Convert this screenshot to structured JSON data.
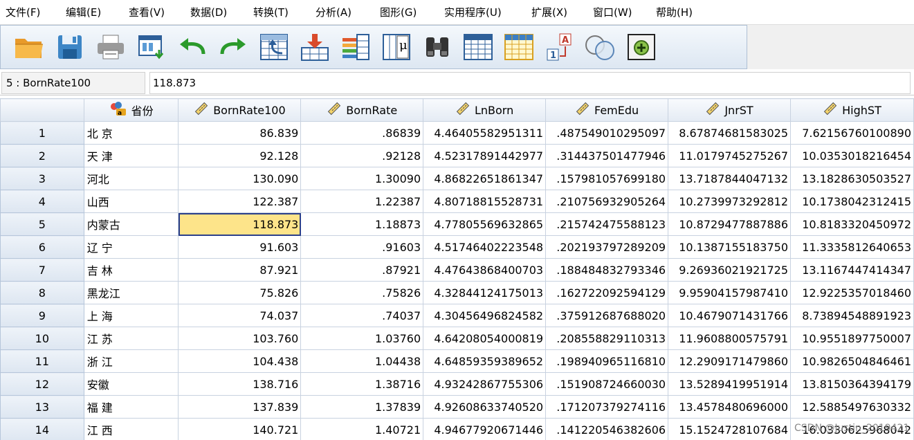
{
  "menu": [
    "文件(F)",
    "编辑(E)",
    "查看(V)",
    "数据(D)",
    "转换(T)",
    "分析(A)",
    "图形(G)",
    "实用程序(U)",
    "扩展(X)",
    "窗口(W)",
    "帮助(H)"
  ],
  "toolbar": {
    "icons": [
      "open-folder-icon",
      "save-icon",
      "print-icon",
      "recall-dialog-icon",
      "undo-icon",
      "redo-icon",
      "goto-case-icon",
      "goto-variable-icon",
      "variables-icon",
      "run-descriptives-icon",
      "find-icon",
      "insert-cases-icon",
      "insert-variable-icon",
      "value-labels-icon",
      "use-sets-icon",
      "customize-icon"
    ]
  },
  "refbar": {
    "cell_name": "5 : BornRate100",
    "cell_value": "118.873"
  },
  "columns": [
    {
      "name": "省份",
      "icon": "nominal-icon"
    },
    {
      "name": "BornRate100",
      "icon": "ruler-icon"
    },
    {
      "name": "BornRate",
      "icon": "ruler-icon"
    },
    {
      "name": "LnBorn",
      "icon": "ruler-icon"
    },
    {
      "name": "FemEdu",
      "icon": "ruler-icon"
    },
    {
      "name": "JnrST",
      "icon": "ruler-icon"
    },
    {
      "name": "HighST",
      "icon": "ruler-icon"
    }
  ],
  "rows": [
    {
      "n": "1",
      "cells": [
        "北 京",
        "86.839",
        ".86839",
        "4.46405582951311",
        ".487549010295097",
        "8.67874681583025",
        "7.62156760100890"
      ]
    },
    {
      "n": "2",
      "cells": [
        "天 津",
        "92.128",
        ".92128",
        "4.52317891442977",
        ".314437501477946",
        "11.0179745275267",
        "10.0353018216454"
      ]
    },
    {
      "n": "3",
      "cells": [
        "河北",
        "130.090",
        "1.30090",
        "4.86822651861347",
        ".157981057699180",
        "13.7187844047132",
        "13.1828630503527"
      ]
    },
    {
      "n": "4",
      "cells": [
        "山西",
        "122.387",
        "1.22387",
        "4.80718815528731",
        ".210756932905264",
        "10.2739973292812",
        "10.1738042312415"
      ]
    },
    {
      "n": "5",
      "cells": [
        "内蒙古",
        "118.873",
        "1.18873",
        "4.77805569632865",
        ".215742475588123",
        "10.8729477887886",
        "10.8183320450972"
      ]
    },
    {
      "n": "6",
      "cells": [
        "辽 宁",
        "91.603",
        ".91603",
        "4.51746402223548",
        ".202193797289209",
        "10.1387155183750",
        "11.3335812640653"
      ]
    },
    {
      "n": "7",
      "cells": [
        "吉 林",
        "87.921",
        ".87921",
        "4.47643868400703",
        ".188484832793346",
        "9.26936021921725",
        "13.1167447414347"
      ]
    },
    {
      "n": "8",
      "cells": [
        "黑龙江",
        "75.826",
        ".75826",
        "4.32844124175013",
        ".162722092594129",
        "9.95904157987410",
        "12.9225357018460"
      ]
    },
    {
      "n": "9",
      "cells": [
        "上 海",
        "74.037",
        ".74037",
        "4.30456496824582",
        ".375912687688020",
        "10.4679071431766",
        "8.73894548891923"
      ]
    },
    {
      "n": "10",
      "cells": [
        "江 苏",
        "103.760",
        "1.03760",
        "4.64208054000819",
        ".208558829110313",
        "11.9608800575791",
        "10.9551897750007"
      ]
    },
    {
      "n": "11",
      "cells": [
        "浙 江",
        "104.438",
        "1.04438",
        "4.64859359389652",
        ".198940965116810",
        "12.2909171479860",
        "10.9826504846461"
      ]
    },
    {
      "n": "12",
      "cells": [
        "安徽",
        "138.716",
        "1.38716",
        "4.93242867755306",
        ".151908724660030",
        "13.5289419951914",
        "13.8150364394179"
      ]
    },
    {
      "n": "13",
      "cells": [
        "福 建",
        "137.839",
        "1.37839",
        "4.92608633740520",
        ".171207379274116",
        "13.4578480696000",
        "12.5885497630332"
      ]
    },
    {
      "n": "14",
      "cells": [
        "江 西",
        "140.721",
        "1.40721",
        "4.94677920671446",
        ".141220546382606",
        "15.1524728107684",
        "16.0330625968042"
      ]
    }
  ],
  "selected": {
    "row": 5,
    "col": 1
  },
  "watermark": "CSDN @Justin_2019421"
}
